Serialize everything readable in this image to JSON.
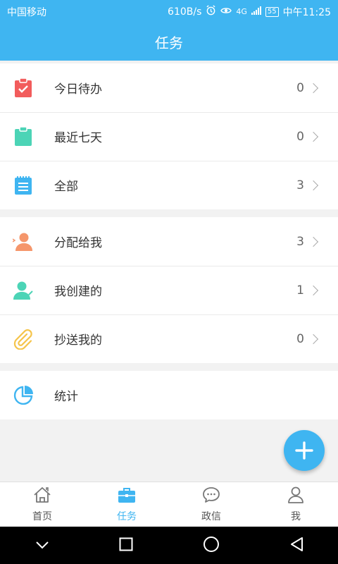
{
  "status": {
    "carrier": "中国移动",
    "speed": "610B/s",
    "network": "4G",
    "battery": "55",
    "time": "中午11:25"
  },
  "header": {
    "title": "任务"
  },
  "groups": [
    {
      "items": [
        {
          "label": "今日待办",
          "count": "0",
          "icon": "clipboard-check-icon",
          "color": "#f25c5c"
        },
        {
          "label": "最近七天",
          "count": "0",
          "icon": "clipboard-icon",
          "color": "#4cd4b6"
        },
        {
          "label": "全部",
          "count": "3",
          "icon": "notepad-list-icon",
          "color": "#3fb5f1"
        }
      ]
    },
    {
      "items": [
        {
          "label": "分配给我",
          "count": "3",
          "icon": "user-assigned-icon",
          "color": "#f5966b"
        },
        {
          "label": "我创建的",
          "count": "1",
          "icon": "user-create-icon",
          "color": "#4cd4b6"
        },
        {
          "label": "抄送我的",
          "count": "0",
          "icon": "paperclip-icon",
          "color": "#f5c44a"
        }
      ]
    },
    {
      "items": [
        {
          "label": "统计",
          "icon": "pie-chart-icon",
          "color": "#3fb5f1"
        }
      ]
    }
  ],
  "tabs": [
    {
      "label": "首页",
      "icon": "home-icon"
    },
    {
      "label": "任务",
      "icon": "briefcase-icon",
      "active": true
    },
    {
      "label": "政信",
      "icon": "chat-bubble-icon"
    },
    {
      "label": "我",
      "icon": "person-icon"
    }
  ],
  "colors": {
    "accent": "#3fb5f1"
  }
}
